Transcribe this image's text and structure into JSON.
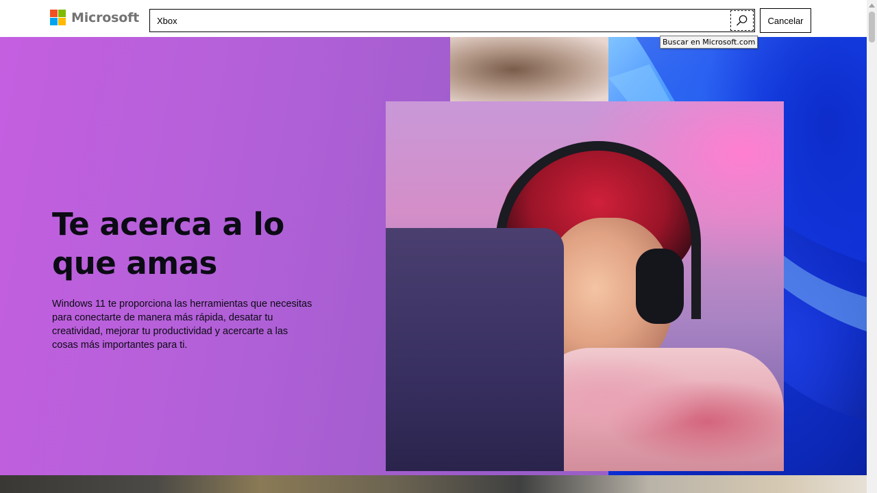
{
  "header": {
    "logo": {
      "text": "Microsoft",
      "icon": "microsoft-logo-icon",
      "colors": [
        "#f25022",
        "#7fba00",
        "#00a4ef",
        "#ffb900"
      ]
    },
    "search": {
      "value": "Xbox",
      "button_icon": "search-icon",
      "tooltip": "Buscar en Microsoft.com"
    },
    "cancel_label": "Cancelar"
  },
  "hero": {
    "title": "Te acerca a lo que amas",
    "description": "Windows 11 te proporciona las herramientas que necesitas para conectarte de manera más rápida, desatar tu creatividad, mejorar tu productividad y acercarte a las cosas más importantes para ti.",
    "image": "person-wearing-headset-gaming-image",
    "colors": {
      "background": "#b260d8",
      "text": "#0b0b14"
    }
  },
  "scrollbar": {
    "up_icon": "scroll-up-arrow-icon"
  }
}
